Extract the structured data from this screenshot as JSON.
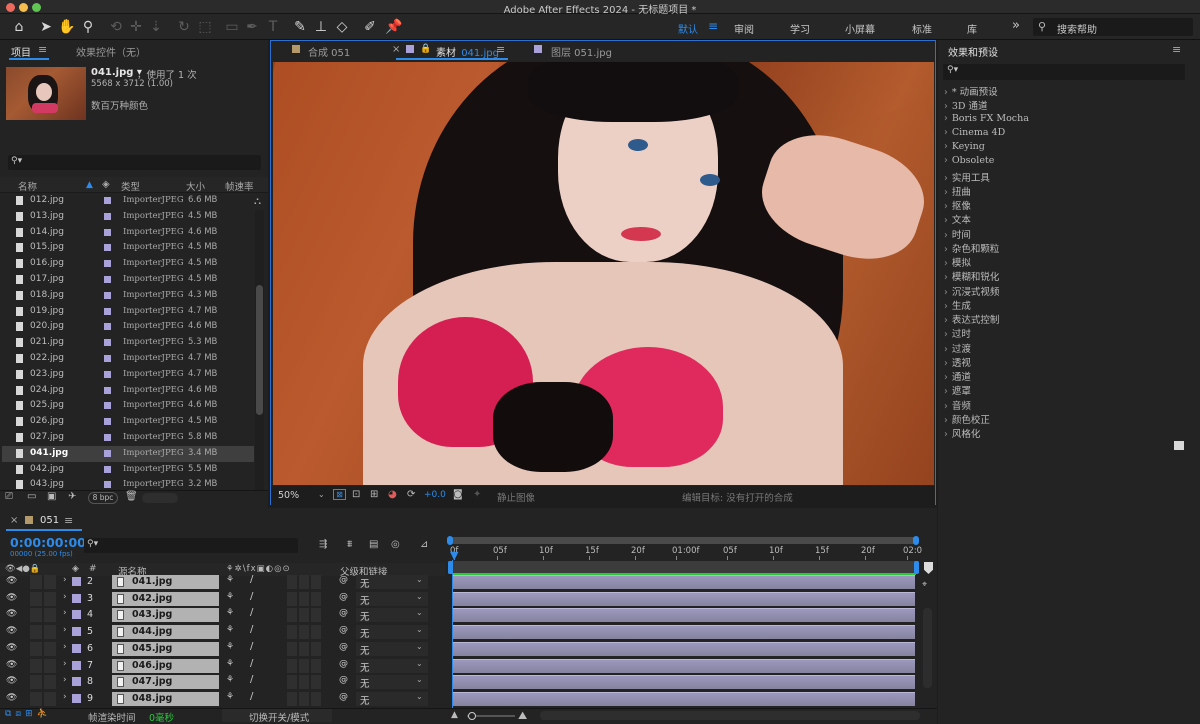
{
  "window": {
    "title": "Adobe After Effects 2024 - 无标题项目 *"
  },
  "toolbar": {
    "workspaces": [
      "默认",
      "审阅",
      "学习",
      "小屏幕",
      "标准",
      "库"
    ],
    "more_glyph": "»",
    "help_placeholder": "搜索帮助"
  },
  "project_panel": {
    "tab_project": "项目",
    "tab_effect_controls": "效果控件（无）",
    "preview": {
      "name": "041.jpg ▾",
      "usage": "，使用了 1 次",
      "dimensions": "5568 x 3712 (1.00)",
      "colors": "数百万种颜色"
    },
    "search_glyph": "⚲▾",
    "columns": {
      "name": "名称",
      "type": "类型",
      "size": "大小",
      "framerate": "帧速率"
    },
    "items": [
      {
        "name": "012.jpg",
        "type": "ImporterJPEG",
        "size": "6.6 MB"
      },
      {
        "name": "013.jpg",
        "type": "ImporterJPEG",
        "size": "4.5 MB"
      },
      {
        "name": "014.jpg",
        "type": "ImporterJPEG",
        "size": "4.6 MB"
      },
      {
        "name": "015.jpg",
        "type": "ImporterJPEG",
        "size": "4.5 MB"
      },
      {
        "name": "016.jpg",
        "type": "ImporterJPEG",
        "size": "4.5 MB"
      },
      {
        "name": "017.jpg",
        "type": "ImporterJPEG",
        "size": "4.5 MB"
      },
      {
        "name": "018.jpg",
        "type": "ImporterJPEG",
        "size": "4.3 MB"
      },
      {
        "name": "019.jpg",
        "type": "ImporterJPEG",
        "size": "4.7 MB"
      },
      {
        "name": "020.jpg",
        "type": "ImporterJPEG",
        "size": "4.6 MB"
      },
      {
        "name": "021.jpg",
        "type": "ImporterJPEG",
        "size": "5.3 MB"
      },
      {
        "name": "022.jpg",
        "type": "ImporterJPEG",
        "size": "4.7 MB"
      },
      {
        "name": "023.jpg",
        "type": "ImporterJPEG",
        "size": "4.7 MB"
      },
      {
        "name": "024.jpg",
        "type": "ImporterJPEG",
        "size": "4.6 MB"
      },
      {
        "name": "025.jpg",
        "type": "ImporterJPEG",
        "size": "4.6 MB"
      },
      {
        "name": "026.jpg",
        "type": "ImporterJPEG",
        "size": "4.5 MB"
      },
      {
        "name": "027.jpg",
        "type": "ImporterJPEG",
        "size": "5.8 MB"
      },
      {
        "name": "041.jpg",
        "type": "ImporterJPEG",
        "size": "3.4 MB",
        "selected": true
      },
      {
        "name": "042.jpg",
        "type": "ImporterJPEG",
        "size": "5.5 MB"
      },
      {
        "name": "043.jpg",
        "type": "ImporterJPEG",
        "size": "3.2 MB"
      }
    ],
    "bpc": "8 bpc"
  },
  "viewer": {
    "tabs": [
      {
        "label": "合成 051",
        "color": "#b49a6a"
      },
      {
        "label": "素材",
        "accent_label": "041.jpg",
        "color": "#a9a1d9",
        "active": true
      },
      {
        "label": "图层 051.jpg",
        "color": "#a9a1d9"
      }
    ],
    "footer": {
      "zoom": "50%",
      "exposure": "+0.0",
      "still_image": "静止图像",
      "edit_target": "编辑目标: 没有打开的合成"
    }
  },
  "effects_panel": {
    "title": "效果和预设",
    "search_glyph": "⚲▾",
    "categories": [
      "* 动画预设",
      "3D 通道",
      "Boris FX Mocha",
      "Cinema 4D",
      "Keying",
      "Obsolete",
      "实用工具",
      "扭曲",
      "抠像",
      "文本",
      "时间",
      "杂色和颗粒",
      "模拟",
      "模糊和锐化",
      "沉浸式视频",
      "生成",
      "表达式控制",
      "过时",
      "过渡",
      "透视",
      "通道",
      "遮罩",
      "音频",
      "颜色校正",
      "风格化"
    ]
  },
  "timeline": {
    "comp_name": "051",
    "timecode": "0:00:00:00",
    "timecode_sub": "00000 (25.00 fps)",
    "search_glyph": "⚲▾",
    "headers": {
      "hash": "#",
      "source_name": "源名称",
      "parent": "父级和链接"
    },
    "ruler": [
      "0f",
      "05f",
      "10f",
      "15f",
      "20f",
      "01:00f",
      "05f",
      "10f",
      "15f",
      "20f",
      "02:0"
    ],
    "layers": [
      {
        "num": "2",
        "name": "041.jpg",
        "parent": "无"
      },
      {
        "num": "3",
        "name": "042.jpg",
        "parent": "无"
      },
      {
        "num": "4",
        "name": "043.jpg",
        "parent": "无"
      },
      {
        "num": "5",
        "name": "044.jpg",
        "parent": "无"
      },
      {
        "num": "6",
        "name": "045.jpg",
        "parent": "无"
      },
      {
        "num": "7",
        "name": "046.jpg",
        "parent": "无"
      },
      {
        "num": "8",
        "name": "047.jpg",
        "parent": "无"
      },
      {
        "num": "9",
        "name": "048.jpg",
        "parent": "无"
      }
    ],
    "footer": {
      "render_time_label": "帧渲染时间",
      "render_time_value": "0毫秒",
      "toggle_modes": "切换开关/模式"
    }
  },
  "colors": {
    "accent": "#2d8ceb",
    "label_lavender": "#a9a1d9",
    "label_tan": "#b49a6a",
    "work_area_green": "#2bc93e"
  }
}
